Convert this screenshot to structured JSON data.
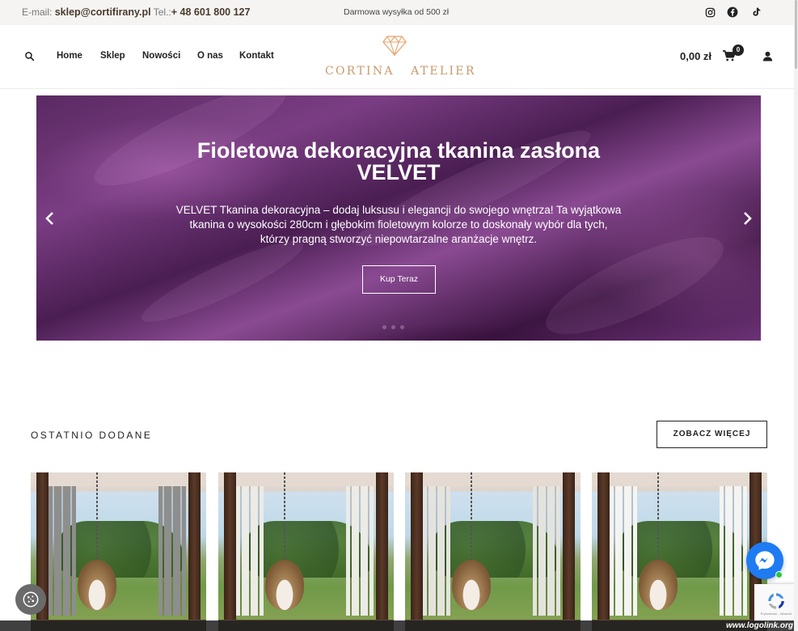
{
  "topbar": {
    "email_label": "E-mail:",
    "email": "sklep@cortifirany.pl",
    "phone_label": "Tel.:",
    "phone": "+ 48 601 800 127",
    "shipping": "Darmowa wysyłka od 500 zł",
    "social": [
      "instagram-icon",
      "facebook-icon",
      "tiktok-icon"
    ]
  },
  "header": {
    "nav": [
      "Home",
      "Sklep",
      "Nowości",
      "O nas",
      "Kontakt"
    ],
    "logo_text": "CORTINA   ATELIER",
    "cart_total": "0,00 zł",
    "cart_count": "0",
    "colors": {
      "logo": "#c79a6d",
      "text": "#222222"
    }
  },
  "hero": {
    "title": "Fioletowa dekoracyjna tkanina zasłona VELVET",
    "description": "VELVET Tkanina dekoracyjna – dodaj luksusu i elegancji do swojego wnętrza! Ta wyjątkowa tkanina o wysokości 280cm i głębokim fioletowym kolorze to doskonały wybór dla tych, którzy pragną stworzyć niepowtarzalne aranżacje wnętrz.",
    "cta": "Kup Teraz",
    "background_color": "#6b3275"
  },
  "recent": {
    "title": "OSTATNIO DODANE",
    "more_button": "ZOBACZ WIĘCEJ",
    "products": [
      {
        "curtain_color": "#8e8e8c"
      },
      {
        "curtain_color": "#ecebe6"
      },
      {
        "curtain_color": "#e4e3de"
      },
      {
        "curtain_color": "#f4f4f2"
      }
    ]
  },
  "widgets": {
    "recaptcha_text": "Prywatność - Warunki",
    "watermark": "www.logolink.org"
  }
}
